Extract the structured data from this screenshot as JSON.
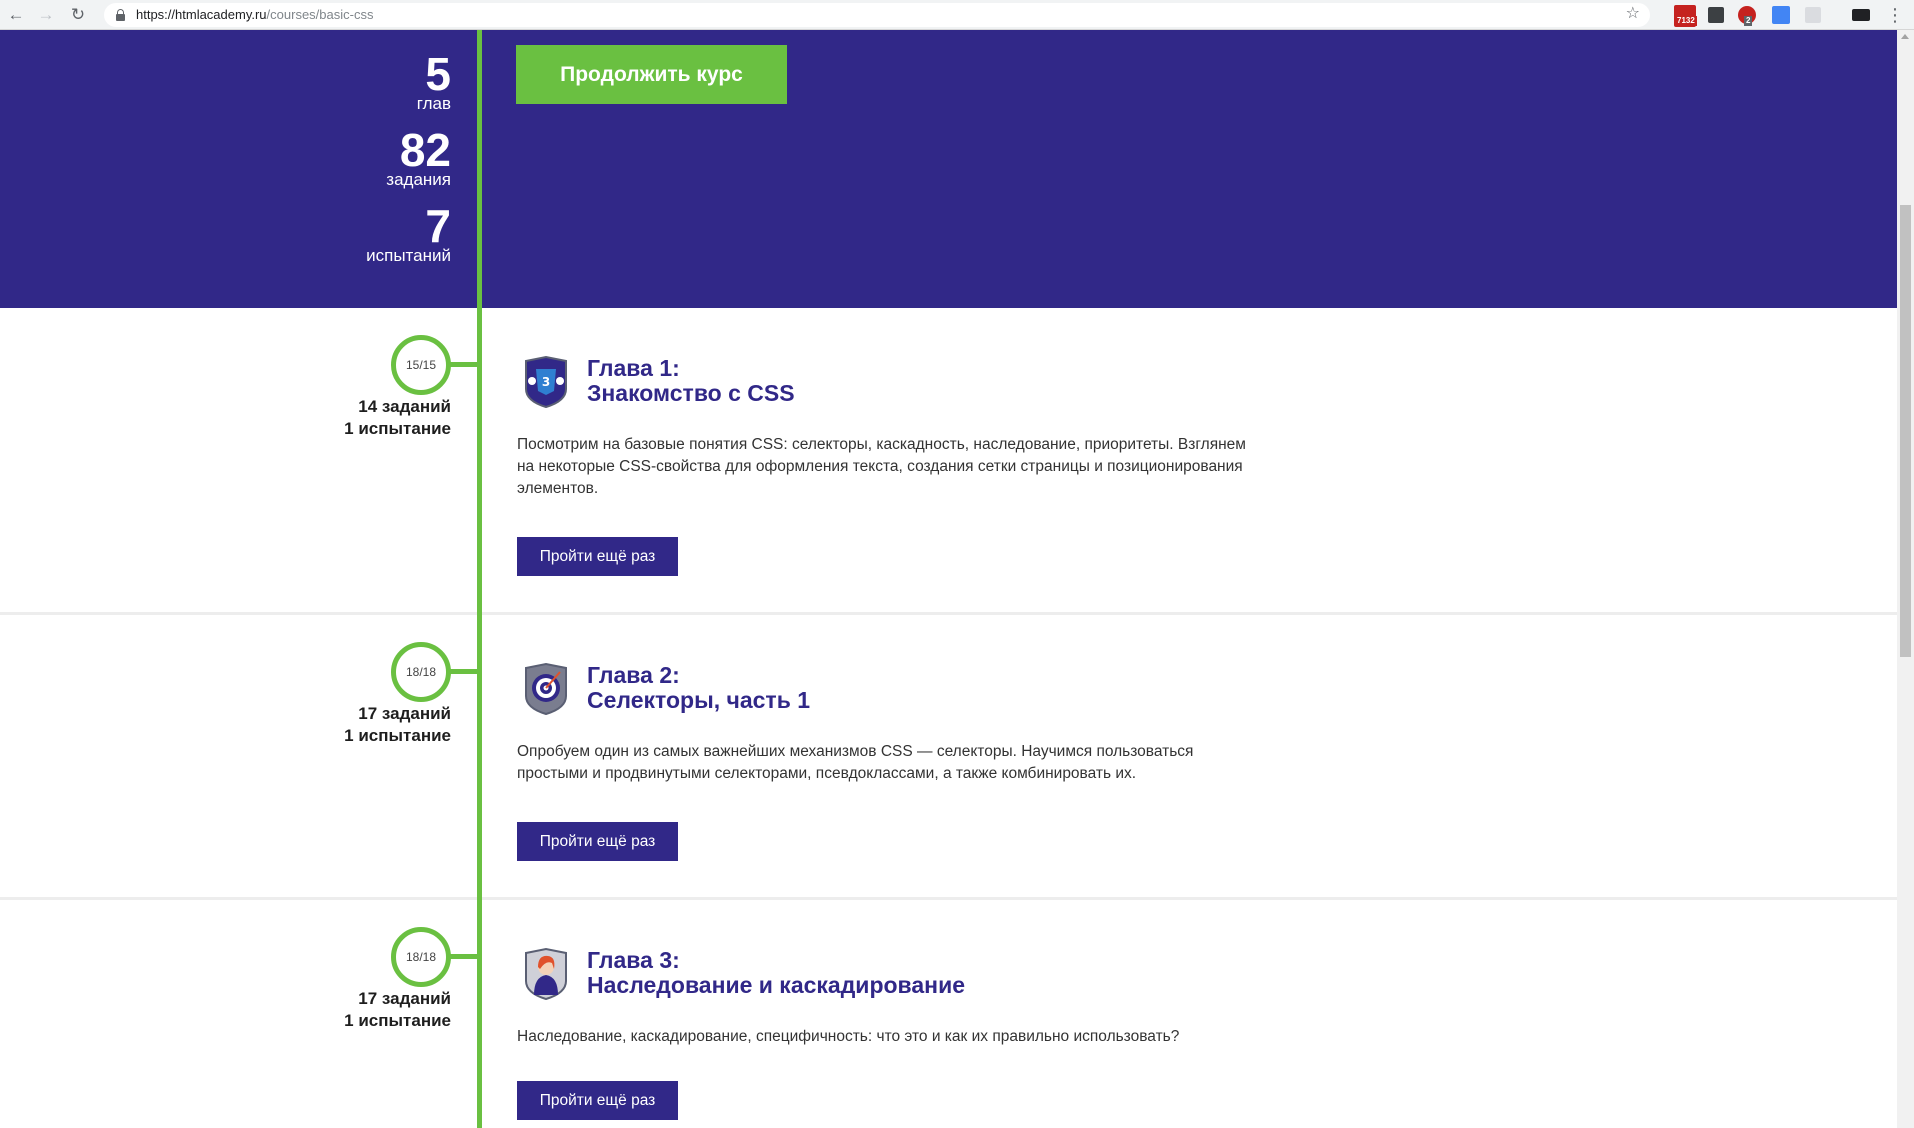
{
  "browser": {
    "url_host": "https://htmlacademy.ru",
    "url_path": "/courses/basic-css",
    "extension_badges": [
      "7132",
      "2"
    ]
  },
  "hero": {
    "stats": [
      {
        "number": "5",
        "label": "глав"
      },
      {
        "number": "82",
        "label": "задания"
      },
      {
        "number": "7",
        "label": "испытаний"
      }
    ],
    "continue_label": "Продолжить курс"
  },
  "chapters": [
    {
      "progress": "15/15",
      "tasks": "14 заданий",
      "trials": "1 испытание",
      "title_line1": "Глава 1:",
      "title_line2": "Знакомство с CSS",
      "description": "Посмотрим на базовые понятия CSS: селекторы, каскадность, наследование, приоритеты. Взглянем на некоторые CSS-свойства для оформления текста, создания сетки страницы и позиционирования элементов.",
      "button_label": "Пройти ещё раз",
      "badge_icon": "css3-shield-icon"
    },
    {
      "progress": "18/18",
      "tasks": "17 заданий",
      "trials": "1 испытание",
      "title_line1": "Глава 2:",
      "title_line2": "Селекторы, часть 1",
      "description": "Опробуем один из самых важнейших механизмов CSS — селекторы. Научимся пользоваться простыми и продвинутыми селекторами, псевдоклассами, а также комбинировать их.",
      "button_label": "Пройти ещё раз",
      "badge_icon": "target-shield-icon"
    },
    {
      "progress": "18/18",
      "tasks": "17 заданий",
      "trials": "1 испытание",
      "title_line1": "Глава 3:",
      "title_line2": "Наследование и каскадирование",
      "description": "Наследование, каскадирование, специфичность: что это и как их правильно использовать?",
      "button_label": "Пройти ещё раз",
      "badge_icon": "portrait-shield-icon"
    }
  ],
  "colors": {
    "brand_purple": "#312888",
    "accent_green": "#6ac041"
  }
}
